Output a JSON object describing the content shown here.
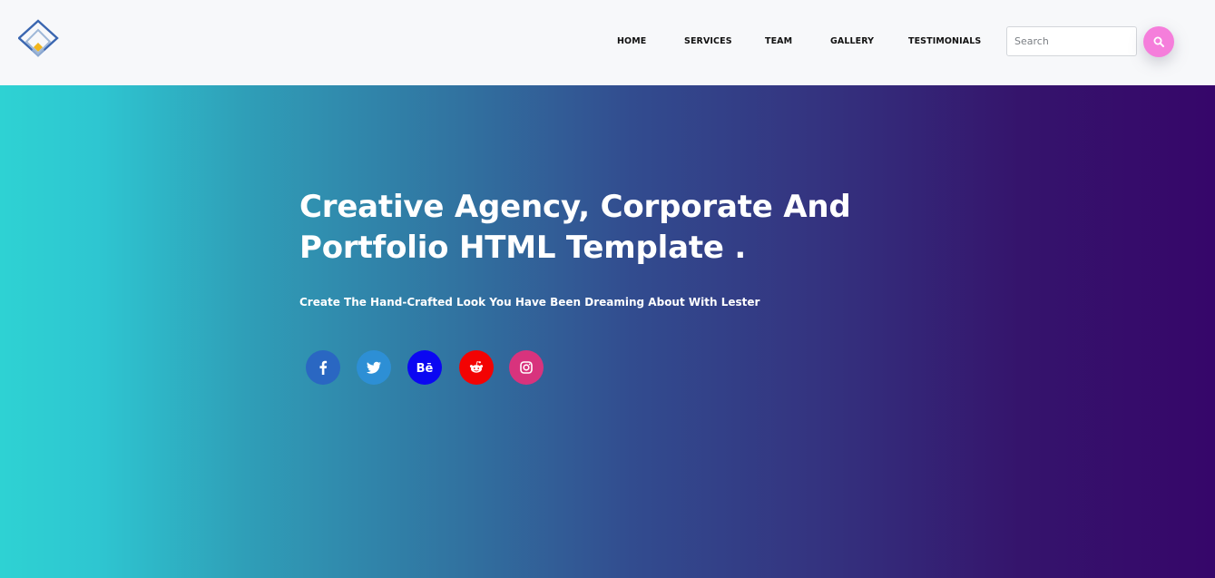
{
  "header": {
    "nav": [
      {
        "label": "HOME"
      },
      {
        "label": "SERVICES"
      },
      {
        "label": "TEAM"
      },
      {
        "label": "GALLERY"
      },
      {
        "label": "TESTIMONIALS"
      }
    ],
    "search": {
      "placeholder": "Search",
      "value": "",
      "button_icon": "search-icon",
      "button_color": "#f57edb"
    },
    "logo_icon": "diamond-logo-icon"
  },
  "hero": {
    "title": "Creative Agency, Corporate And Portfolio HTML Template .",
    "subtitle": "Create The Hand-Crafted Look You Have Been Dreaming About With Lester",
    "gradient_start": "#2ed2d3",
    "gradient_end": "#36066a",
    "social": [
      {
        "icon": "facebook-icon",
        "color": "#3b5998"
      },
      {
        "icon": "twitter-icon",
        "color": "#1da1f2"
      },
      {
        "icon": "behance-icon",
        "color": "#0000ff"
      },
      {
        "icon": "reddit-icon",
        "color": "#ff0000"
      },
      {
        "icon": "instagram-icon",
        "color": "#dd2a7b"
      }
    ]
  }
}
